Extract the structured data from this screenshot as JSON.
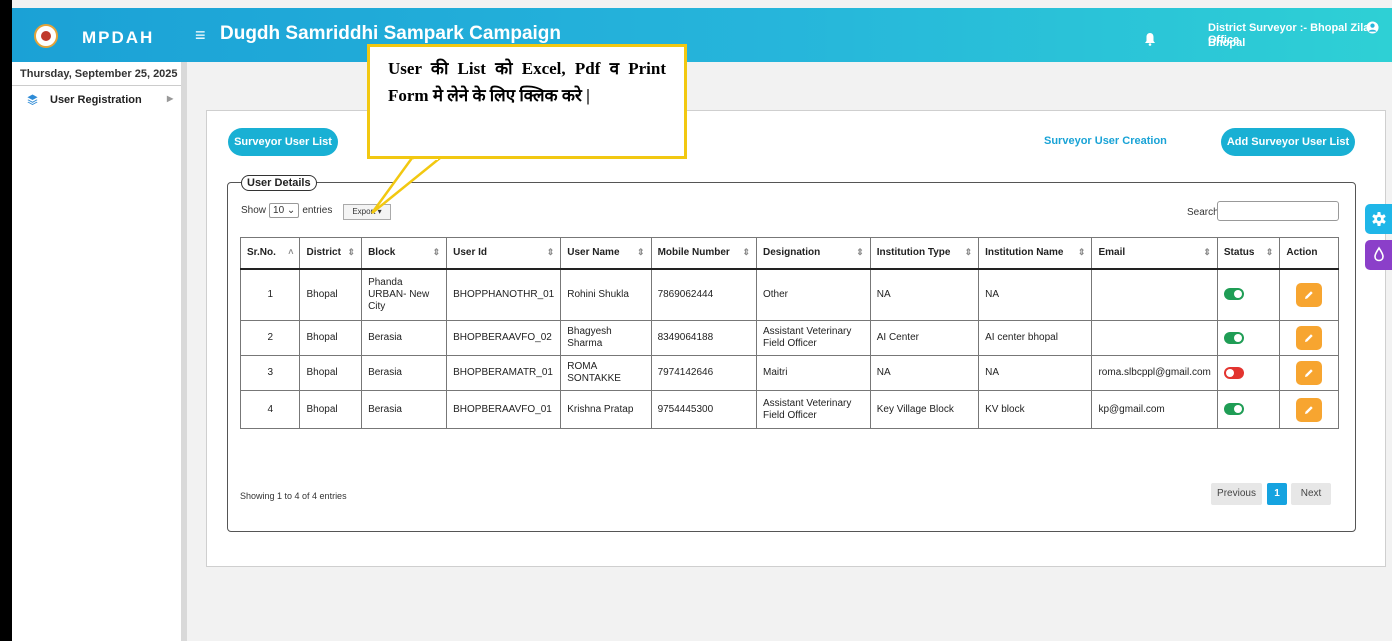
{
  "header": {
    "brand": "MPDAH",
    "title": "Dugdh Samriddhi Sampark Campaign",
    "user_role": "District Surveyor :- Bhopal Zila Office",
    "user_location": "Bhopal"
  },
  "sidebar": {
    "date": "Thursday, September 25, 2025",
    "items": [
      {
        "label": "User Registration"
      }
    ]
  },
  "toolbar": {
    "list_button": "Surveyor User List",
    "create_link": "Surveyor User Creation",
    "add_button": "Add Surveyor User List"
  },
  "details": {
    "legend": "User Details",
    "show_label": "Show",
    "entries_value": "10",
    "entries_label": "entries",
    "export_label": "Export",
    "search_label": "Search:",
    "search_value": ""
  },
  "table": {
    "headers": [
      "Sr.No.",
      "District",
      "Block",
      "User Id",
      "User Name",
      "Mobile Number",
      "Designation",
      "Institution Type",
      "Institution Name",
      "Email",
      "Status",
      "Action"
    ],
    "rows": [
      {
        "sr": "1",
        "district": "Bhopal",
        "block": "Phanda URBAN- New City",
        "user_id": "BHOPPHANOTHR_01",
        "user_name": "Rohini Shukla",
        "mobile": "7869062444",
        "designation": "Other",
        "inst_type": "NA",
        "inst_name": "NA",
        "email": "",
        "status": "active"
      },
      {
        "sr": "2",
        "district": "Bhopal",
        "block": "Berasia",
        "user_id": "BHOPBERAAVFO_02",
        "user_name": "Bhagyesh Sharma",
        "mobile": "8349064188",
        "designation": "Assistant Veterinary Field Officer",
        "inst_type": "AI Center",
        "inst_name": "AI center bhopal",
        "email": "",
        "status": "active"
      },
      {
        "sr": "3",
        "district": "Bhopal",
        "block": "Berasia",
        "user_id": "BHOPBERAMATR_01",
        "user_name": "ROMA SONTAKKE",
        "mobile": "7974142646",
        "designation": "Maitri",
        "inst_type": "NA",
        "inst_name": "NA",
        "email": "roma.slbcppl@gmail.com",
        "status": "inactive"
      },
      {
        "sr": "4",
        "district": "Bhopal",
        "block": "Berasia",
        "user_id": "BHOPBERAAVFO_01",
        "user_name": "Krishna Pratap",
        "mobile": "9754445300",
        "designation": "Assistant Veterinary Field Officer",
        "inst_type": "Key Village Block",
        "inst_name": "KV block",
        "email": "kp@gmail.com",
        "status": "active"
      }
    ]
  },
  "footer": {
    "info": "Showing 1 to 4 of 4 entries",
    "prev": "Previous",
    "page": "1",
    "next": "Next"
  },
  "callout": {
    "text": "User की List को Excel, Pdf व Print Form मे लेने के लिए क्लिक करे |"
  },
  "colors": {
    "accent": "#19b0d4",
    "status_active": "#1f9d55",
    "status_inactive": "#e3342f",
    "edit_button": "#f7a530"
  }
}
